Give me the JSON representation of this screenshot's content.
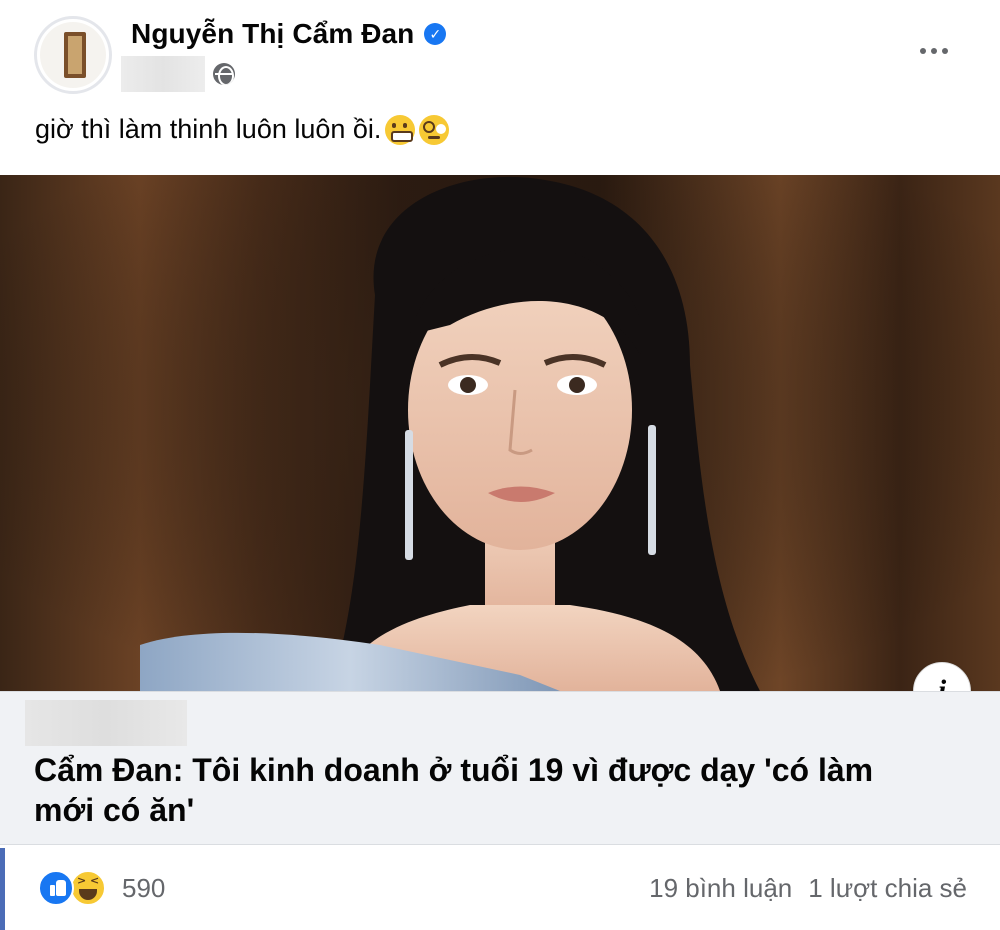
{
  "post": {
    "author": {
      "name": "Nguyễn Thị Cẩm Đan",
      "verified_icon": "verified-badge-icon",
      "privacy_icon": "globe-icon"
    },
    "caption": "giờ thì làm thinh luôn luôn ồi.",
    "caption_emojis": [
      "grimacing-face-emoji",
      "dizzy-face-emoji"
    ],
    "link": {
      "title": "Cẩm Đan: Tôi kinh doanh ở tuổi 19 vì được dạy 'có làm mới có ăn'",
      "info_label": "i"
    },
    "footer": {
      "reaction_icons": [
        "like-icon",
        "haha-icon"
      ],
      "reaction_count": "590",
      "comments": "19 bình luận",
      "shares": "1 lượt chia sẻ"
    }
  },
  "colors": {
    "link_background": "#f0f2f5",
    "secondary_text": "#65676b",
    "brand_blue": "#1877f2"
  }
}
